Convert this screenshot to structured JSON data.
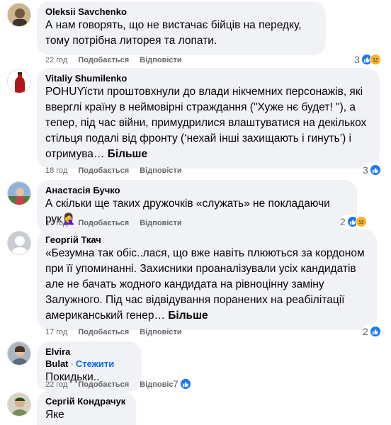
{
  "comments": [
    {
      "author": "Oleksii Savchenko",
      "text": "А нам говорять, що не вистачає бійців на передку, тому потрібна литорея та лопати.",
      "time": "22 год",
      "like_label": "Подобається",
      "reply_label": "Відповісти",
      "reaction_count": "3",
      "reactions": [
        "like-icon",
        "sad-icon"
      ]
    },
    {
      "author": "Vitaliy Shumilenko",
      "text": "РОНUYїсти проштовхнули до влади нікчемних персонажів, які вверглі країну в неймовірні страждання (\"Хуже нє будет! \"), а тепер, під час війни, примудрилися влаштуватися на декількох стільця подалі від фронту (‘нехай інші захищають і гинуть’) і отримува…",
      "more": "Більше",
      "time": "18 год",
      "like_label": "Подобається",
      "reply_label": "Відповісти",
      "reaction_count": "3",
      "reactions": [
        "like-icon"
      ]
    },
    {
      "author": "Анастасія Бучко",
      "text": "А скільки ще таких дружочків «служать» не покладаючи рук🤦‍♀️",
      "time": "17 год",
      "like_label": "Подобається",
      "reply_label": "Відповісти",
      "reaction_count": "2",
      "reactions": [
        "like-icon",
        "sad-icon"
      ]
    },
    {
      "author": "Георгій Ткач",
      "text": "«Безумна так обіс..лася, що вже навіть плюються за кордоном при її упоминанні. Захисники проаналізували усіх кандидатів але не бачать жодного кандидата на рівноцінну заміну Залужного. Під час відвідування поранених на реабілітації американський генер…",
      "more": "Більше",
      "time": "17 год",
      "like_label": "Подобається",
      "reply_label": "Відповісти",
      "reaction_count": "2",
      "reactions": [
        "like-icon"
      ]
    },
    {
      "author": "Elvira Bulat",
      "follow_label": "Стежити",
      "text": "Покидьки..",
      "time": "22 год",
      "like_label": "Подобається",
      "reply_label": "Відповісти",
      "reaction_count": "7",
      "reactions": [
        "like-icon"
      ]
    },
    {
      "author": "Сергій Кондрачук",
      "text": "Яке позорисько…"
    }
  ],
  "colors": {
    "bubble": "#f0f2f5",
    "meta": "#65676b",
    "like": "#1877f2",
    "sad": "#f7b125",
    "follow": "#0866ff"
  }
}
